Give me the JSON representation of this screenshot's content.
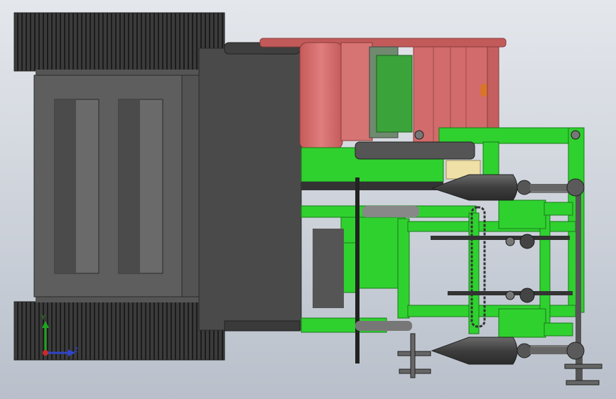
{
  "scene": {
    "description_hidden": "",
    "view": "top",
    "colors": {
      "background_top": "#e4e7ec",
      "background_bottom": "#b9c0cb",
      "track": "#3a3a3a",
      "track_tread": "#1e1e1e",
      "body_dark": "#4a4a4a",
      "body_mid": "#606060",
      "body_light": "#7a7a7a",
      "cab_red": "#d46b6b",
      "cab_red_dark": "#b65252",
      "frame_green": "#2fd12f",
      "frame_green_dark": "#1f9a1f",
      "steel": "#5c5c5c",
      "cone": "#444444",
      "cream": "#efe0a8",
      "orange": "#d9752a"
    }
  },
  "triad": {
    "y_label": "Y",
    "x_label": "",
    "z_label": "Z"
  }
}
